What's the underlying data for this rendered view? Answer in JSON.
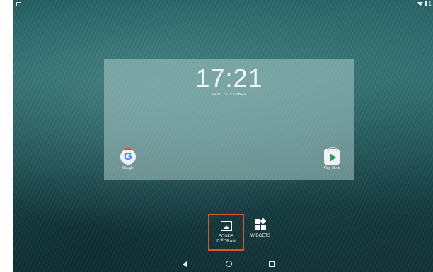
{
  "status_bar": {
    "left_icon": "notification-icon",
    "right_icons": [
      "wifi-icon",
      "battery-icon"
    ],
    "right_text": "1"
  },
  "lockscreen_preview": {
    "time": "17:21",
    "date": "VEN. 2 OCTOBRE",
    "apps": [
      {
        "label": "Google",
        "icon": "google-icon"
      },
      {
        "label": "Play Store",
        "icon": "play-store-icon"
      }
    ]
  },
  "actions": {
    "wallpapers_label_line1": "FONDS",
    "wallpapers_label_line2": "D'ÉCRAN",
    "widgets_label": "WIDGETS",
    "highlight_color": "#e1541f"
  },
  "nav_bar": {
    "buttons": [
      "back-icon",
      "home-icon",
      "recents-icon"
    ]
  }
}
